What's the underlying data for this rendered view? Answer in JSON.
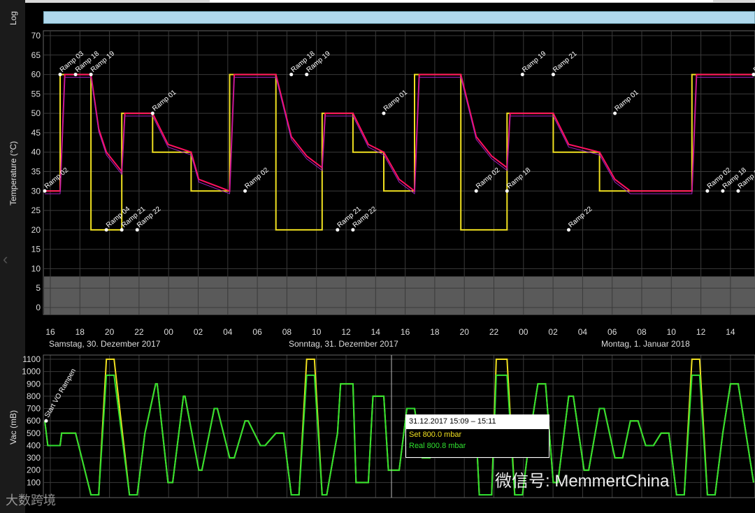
{
  "log_label": "Log",
  "temp_axis": {
    "ylabel": "Temperature (°C)",
    "ticks": [
      "70",
      "65",
      "60",
      "55",
      "50",
      "45",
      "40",
      "35",
      "30",
      "25",
      "20",
      "15",
      "10",
      "5",
      "0"
    ]
  },
  "vac_axis": {
    "ylabel": "Vac (mB)",
    "ticks": [
      "1100",
      "1000",
      "900",
      "800",
      "700",
      "600",
      "500",
      "400",
      "300",
      "200",
      "100"
    ]
  },
  "time_ticks": [
    "16",
    "18",
    "20",
    "22",
    "00",
    "02",
    "04",
    "06",
    "08",
    "10",
    "12",
    "14",
    "16",
    "18",
    "20",
    "22",
    "00",
    "02",
    "04",
    "06",
    "08",
    "10",
    "12",
    "14"
  ],
  "day_labels": [
    "Samstag, 30. Dezember 2017",
    "Sonntag, 31. Dezember 2017",
    "Montag, 1. Januar 2018"
  ],
  "tooltip": {
    "header": "31.12.2017 15:09 – 15:11",
    "set": "Set 800.0 mbar",
    "real": "Real 800.8 mbar"
  },
  "watermark": "微信号: MemmertChina",
  "watermark2": "大数跨境",
  "colors": {
    "set": "#f0e020",
    "real": "#30e030",
    "temp_real": "#ff1060",
    "temp_real2": "#a020c0",
    "grid": "#3a3a3a",
    "band": "#5a5a5a"
  },
  "chart_data": [
    {
      "type": "line",
      "ylabel": "Temperature (°C)",
      "ylim": [
        0,
        70
      ],
      "x_unit": "hours since 30.12.2017 16:00",
      "xlim": [
        0,
        46
      ],
      "series": [
        {
          "name": "Set",
          "x": [
            0,
            1,
            1,
            3,
            3,
            5,
            5,
            7,
            7,
            9.5,
            9.5,
            12,
            12,
            15,
            15,
            18,
            18,
            20,
            20,
            22,
            22,
            24,
            24,
            27,
            27,
            29.5,
            29.5,
            30,
            30,
            33,
            33,
            36,
            36,
            38,
            38,
            42,
            42,
            44,
            44,
            46
          ],
          "values": [
            30,
            30,
            60,
            60,
            20,
            20,
            50,
            50,
            40,
            40,
            30,
            30,
            60,
            60,
            20,
            20,
            50,
            50,
            40,
            40,
            30,
            30,
            60,
            60,
            20,
            20,
            20,
            20,
            50,
            50,
            40,
            40,
            30,
            30,
            30,
            30,
            60,
            60,
            60,
            60
          ]
        },
        {
          "name": "Real",
          "x": [
            0,
            1,
            1.3,
            3,
            3.5,
            4,
            5,
            5.2,
            7,
            8,
            9.5,
            10,
            12,
            12.3,
            15,
            16,
            17,
            18,
            18.2,
            20,
            21,
            22,
            23,
            24,
            24.3,
            27,
            28,
            29,
            30,
            30.2,
            33,
            34,
            36,
            37,
            38,
            42,
            42.3,
            46
          ],
          "values": [
            30,
            30,
            60,
            60,
            46,
            40,
            35,
            50,
            50,
            42,
            40,
            33,
            30,
            60,
            60,
            44,
            39,
            36,
            50,
            50,
            42,
            40,
            33,
            30,
            60,
            60,
            44,
            39,
            36,
            50,
            50,
            42,
            40,
            33,
            30,
            30,
            60,
            60
          ]
        }
      ],
      "annotations": [
        {
          "x": 0,
          "y": 30,
          "text": "Ramp 02"
        },
        {
          "x": 1,
          "y": 60,
          "text": "Ramp 03"
        },
        {
          "x": 2,
          "y": 60,
          "text": "Ramp 18"
        },
        {
          "x": 3,
          "y": 60,
          "text": "Ramp 19"
        },
        {
          "x": 4,
          "y": 20,
          "text": "Ramp 04"
        },
        {
          "x": 5,
          "y": 20,
          "text": "Ramp 21"
        },
        {
          "x": 6,
          "y": 20,
          "text": "Ramp 22"
        },
        {
          "x": 7,
          "y": 50,
          "text": "Ramp 01"
        },
        {
          "x": 13,
          "y": 30,
          "text": "Ramp 02"
        },
        {
          "x": 16,
          "y": 60,
          "text": "Ramp 18"
        },
        {
          "x": 17,
          "y": 60,
          "text": "Ramp 19"
        },
        {
          "x": 19,
          "y": 20,
          "text": "Ramp 21"
        },
        {
          "x": 20,
          "y": 20,
          "text": "Ramp 22"
        },
        {
          "x": 22,
          "y": 50,
          "text": "Ramp 01"
        },
        {
          "x": 28,
          "y": 30,
          "text": "Ramp 02"
        },
        {
          "x": 30,
          "y": 30,
          "text": "Ramp 18"
        },
        {
          "x": 31,
          "y": 60,
          "text": "Ramp 19"
        },
        {
          "x": 33,
          "y": 60,
          "text": "Ramp 21"
        },
        {
          "x": 34,
          "y": 20,
          "text": "Ramp 22"
        },
        {
          "x": 37,
          "y": 50,
          "text": "Ramp 01"
        },
        {
          "x": 43,
          "y": 30,
          "text": "Ramp 02"
        },
        {
          "x": 44,
          "y": 30,
          "text": "Ramp 18"
        },
        {
          "x": 45,
          "y": 30,
          "text": "Ramp 19"
        },
        {
          "x": 46,
          "y": 60,
          "text": "Ramp 03"
        }
      ]
    },
    {
      "type": "line",
      "ylabel": "Vac (mB)",
      "ylim": [
        0,
        1150
      ],
      "x_unit": "hours since 30.12.2017 16:00",
      "xlim": [
        0,
        46
      ],
      "series": [
        {
          "name": "Set",
          "x": [
            0,
            0.2,
            1,
            1.1,
            2,
            3,
            3.5,
            4,
            4.5,
            5.5,
            6,
            6.5,
            7.2,
            7.3,
            8,
            8.3,
            9,
            9.1,
            10,
            10.2,
            11,
            11.2,
            12,
            12.3,
            13,
            13.2,
            14,
            14.3,
            15,
            15.5,
            16,
            16.5,
            17,
            17.5,
            18,
            18.3,
            19,
            19.2,
            20,
            20.2,
            21,
            21.3,
            22,
            22.3,
            23,
            23.5,
            24,
            24.5,
            25,
            25.5,
            26,
            26.2,
            27,
            27.3,
            28,
            28.2,
            29,
            29.3,
            30,
            30.5,
            31,
            31.5,
            32,
            32.5,
            33,
            33.3,
            34,
            34.3,
            35,
            35.3,
            36,
            36.3,
            37,
            37.5,
            38,
            38.5,
            39,
            39.5,
            40,
            40.5,
            41,
            41.5,
            42,
            42.5,
            43,
            43.5,
            44,
            44.5,
            45,
            46
          ],
          "values": [
            600,
            400,
            400,
            500,
            500,
            0,
            0,
            1100,
            1100,
            0,
            0,
            500,
            900,
            900,
            100,
            100,
            800,
            800,
            200,
            200,
            700,
            700,
            300,
            300,
            600,
            600,
            400,
            400,
            500,
            500,
            0,
            0,
            1100,
            1100,
            0,
            0,
            500,
            900,
            900,
            100,
            100,
            800,
            800,
            200,
            200,
            700,
            700,
            300,
            300,
            600,
            600,
            400,
            400,
            500,
            500,
            0,
            0,
            1100,
            1100,
            0,
            0,
            500,
            900,
            900,
            100,
            100,
            800,
            800,
            200,
            200,
            700,
            700,
            300,
            300,
            600,
            600,
            400,
            400,
            500,
            500,
            0,
            0,
            1100,
            1100,
            0,
            0,
            500,
            900,
            900,
            100
          ]
        },
        {
          "name": "Real",
          "x": [
            0,
            46
          ],
          "values": [
            600,
            600
          ]
        }
      ],
      "annotations": [
        {
          "x": 0,
          "y": 600,
          "text": "Start VO Rampen"
        }
      ]
    }
  ]
}
